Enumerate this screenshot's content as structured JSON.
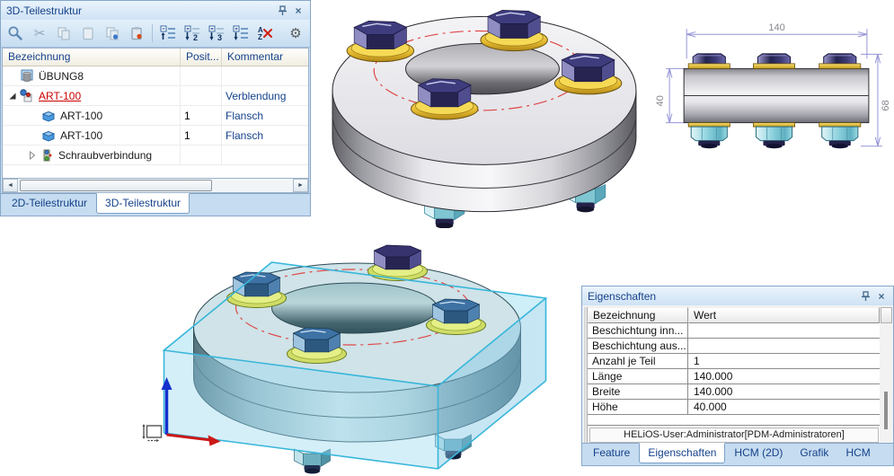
{
  "glyphs": {
    "close": "×",
    "gear": "⚙",
    "scissors": "✂",
    "scroll_left": "◄",
    "scroll_right": "►"
  },
  "part_structure_panel": {
    "title": "3D-Teilestruktur",
    "toolbar": {
      "icons": [
        "search",
        "cut",
        "copy",
        "paste",
        "copy-with-marker",
        "paste-with-marker",
        "collapse-all",
        "expand-level-2",
        "expand-level-3",
        "expand-all",
        "remove-sorting",
        "settings"
      ],
      "level2_label": "2",
      "level3_label": "3",
      "sort_a": "A",
      "sort_z": "Z"
    },
    "columns": [
      "Bezeichnung",
      "Posit...",
      "Kommentar"
    ],
    "rows": [
      {
        "label": "ÜBUNG8",
        "pos": "",
        "comment": "",
        "icon": "drawing-icon",
        "expander": "none"
      },
      {
        "label": "ART-100",
        "pos": "",
        "comment": "Verblendung",
        "icon": "assembly-icon",
        "expander": "expanded",
        "state": "active"
      },
      {
        "label": "ART-100",
        "pos": "1",
        "comment": "Flansch",
        "icon": "part-icon",
        "expander": "none"
      },
      {
        "label": "ART-100",
        "pos": "1",
        "comment": "Flansch",
        "icon": "part-icon",
        "expander": "none"
      },
      {
        "label": "Schraubverbindung",
        "pos": "",
        "comment": "",
        "icon": "bolt-connection-icon",
        "expander": "collapsed"
      }
    ],
    "tabs": [
      {
        "label": "2D-Teilestruktur",
        "active": false
      },
      {
        "label": "3D-Teilestruktur",
        "active": true
      }
    ]
  },
  "properties_panel": {
    "title": "Eigenschaften",
    "columns": [
      "Bezeichnung",
      "Wert"
    ],
    "rows": [
      {
        "name": "Beschichtung inn...",
        "value": ""
      },
      {
        "name": "Beschichtung aus...",
        "value": ""
      },
      {
        "name": "Anzahl je Teil",
        "value": "1"
      },
      {
        "name": "Länge",
        "value": "140.000"
      },
      {
        "name": "Breite",
        "value": "140.000"
      },
      {
        "name": "Höhe",
        "value": "40.000"
      }
    ],
    "status_text": "HELiOS-User:Administrator[PDM-Administratoren]",
    "tabs": [
      {
        "label": "Feature",
        "active": false
      },
      {
        "label": "Eigenschaften",
        "active": true
      },
      {
        "label": "HCM (2D)",
        "active": false
      },
      {
        "label": "Grafik",
        "active": false
      },
      {
        "label": "HCM",
        "active": false
      }
    ]
  },
  "viewport": {
    "renders": [
      "flange-assembly-isometric",
      "flange-front-view-dimensioned",
      "flange-assembly-in-bounding-box"
    ],
    "front_view_dimensions": {
      "width": "140",
      "plate_height": "40",
      "total_height": "68"
    },
    "colors": {
      "bolt_circle": "#e04848",
      "bolt_head": "#2a2860",
      "washer": "#e8c23a",
      "nut": "#8fd0da",
      "glass_box": "#a8dff2",
      "dimension_line": "#9595d8",
      "axis_x": "#cc1818",
      "axis_z": "#1530cc"
    }
  }
}
